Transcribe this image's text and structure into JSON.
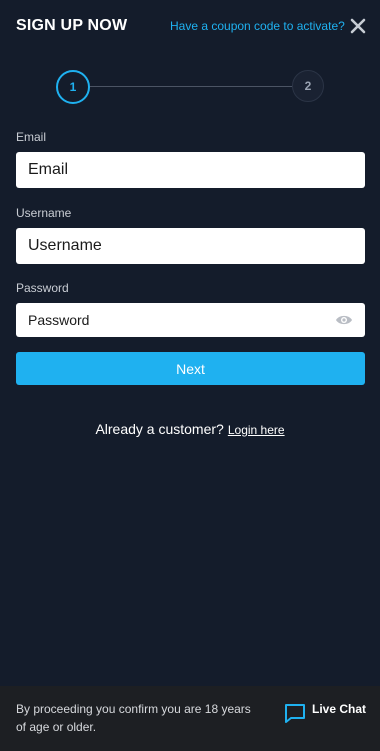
{
  "header": {
    "title": "SIGN UP NOW",
    "coupon_link": "Have a coupon code to activate?",
    "close_icon": "close-icon"
  },
  "stepper": {
    "steps": [
      "1",
      "2"
    ],
    "active_step": "1"
  },
  "form": {
    "email": {
      "label": "Email",
      "placeholder": "Email"
    },
    "username": {
      "label": "Username",
      "placeholder": "Username"
    },
    "password": {
      "label": "Password",
      "placeholder": "Password",
      "toggle_icon": "eye-icon"
    },
    "next_label": "Next"
  },
  "login_prompt": {
    "text": "Already a customer?",
    "link": "Login here"
  },
  "footer": {
    "disclaimer": "By proceeding you confirm you are 18 years of age or older.",
    "live_chat_label": "Live Chat",
    "live_chat_icon": "chat-bubble-icon"
  },
  "colors": {
    "background": "#141c2b",
    "accent": "#1fb1f0",
    "footer_background": "#1d1f23"
  }
}
